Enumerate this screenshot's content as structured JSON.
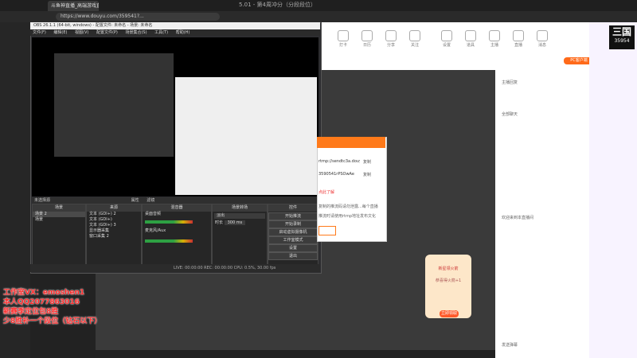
{
  "browser": {
    "tab_title": "斗鱼神直播_高端游戏直播_火热",
    "url": "https://www.douyu.com/359541?...",
    "window_title": "5.01 - 第4周冲分（分段段位）"
  },
  "site": {
    "nav_items": [
      "打卡",
      "日历",
      "分享",
      "关注",
      "设置",
      "道具",
      "主播",
      "直播",
      "消息",
      "PC客户端"
    ],
    "right_chat": [
      "主播回复",
      "发送弹幕",
      "全部聊天",
      "欢迎来到本直播间",
      "贵宾席"
    ],
    "gift_title": "新星领火箭",
    "gift_sub": "恭喜得火箭+1",
    "gift_button": "立即领取",
    "logo_text": "35954"
  },
  "obs": {
    "title": "OBS 26.1.1 (64-bit, windows) - 配置文件: 未命名 - 场景: 未命名",
    "menu": [
      "文件(F)",
      "编辑(E)",
      "视图(V)",
      "配置文件(P)",
      "场景集合(S)",
      "工具(T)",
      "帮助(H)"
    ],
    "tabs": [
      "未选择源",
      "属性",
      "滤镜"
    ],
    "scenes_label": "场景",
    "scenes": [
      "场景 2",
      "场景"
    ],
    "sources_label": "来源",
    "sources": [
      "文本 (GDI+) 2",
      "文本 (GDI+)",
      "文本 (GDI+) 3",
      "显示器采集",
      "窗口采集 2"
    ],
    "mixer_label": "混音器",
    "mixer": [
      "桌面音频",
      "麦克风/Aux"
    ],
    "transition_label": "场景转场",
    "transition": {
      "type": "淡出",
      "duration_label": "时长",
      "duration": "300 ms"
    },
    "controls_label": "控件",
    "controls": [
      "开始推流",
      "开始录制",
      "启动虚拟摄像机",
      "工作室模式",
      "设置",
      "退出"
    ],
    "status": "LIVE: 00:00:00   REC: 00:00:00   CPU: 0.5%, 30.00 fps"
  },
  "dialog": {
    "url_value": "rtmp://sendtc3a.douyu.com/live",
    "copy_label": "复制",
    "key_label": "3590541rPSOwAe",
    "copy2_label": "复制",
    "tip": "点此了解",
    "note1": "复制的推流码请勿泄露...每个直播",
    "note2": "推流时请使用rtmp地址发布文化"
  },
  "overlay": {
    "line1": "工作室VX：emoshen1",
    "line2": "本人QQ2077863016",
    "line3": "新赛季定位包8胜",
    "line4": "少8胜补一个段位（钻石以下）"
  }
}
